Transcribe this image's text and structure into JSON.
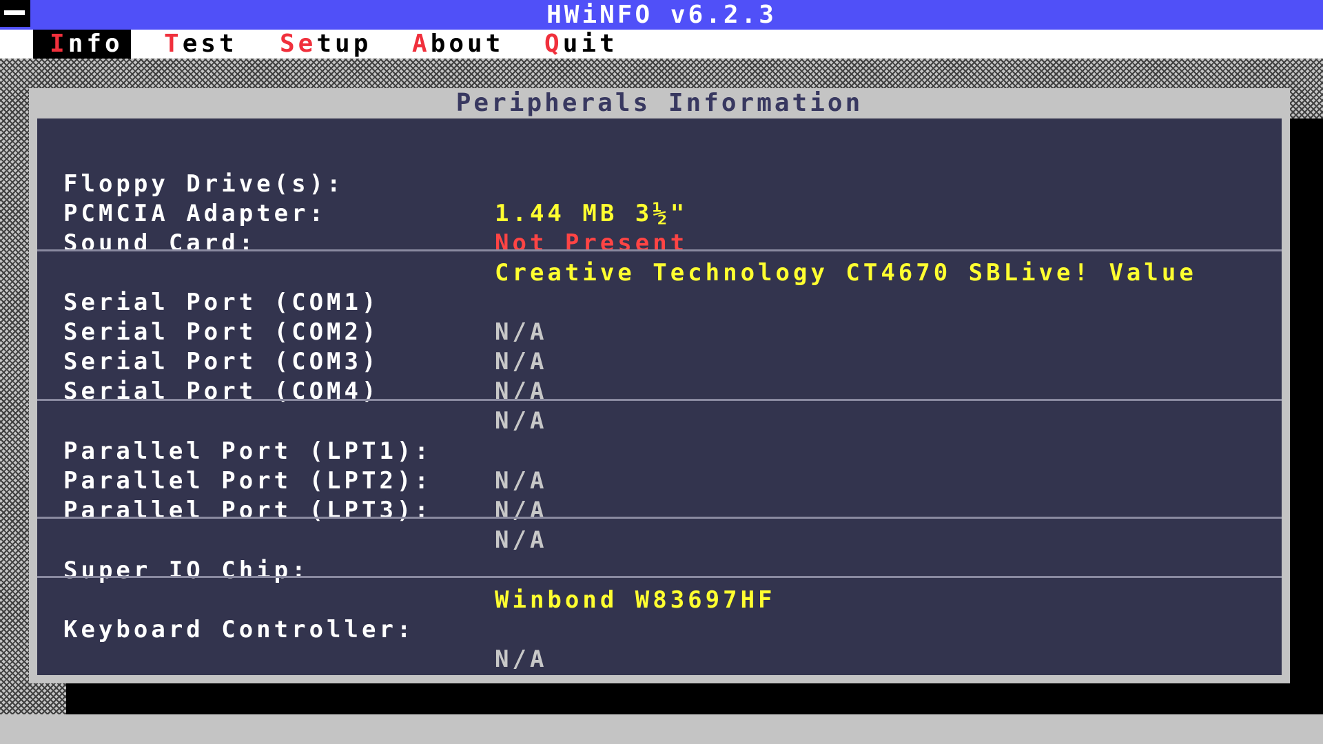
{
  "app": {
    "title": "HWiNFO v6.2.3"
  },
  "menu": [
    {
      "hot": "I",
      "rest": "nfo"
    },
    {
      "hot": "T",
      "rest": "est"
    },
    {
      "hot": "Se",
      "rest": "tup"
    },
    {
      "hot": "A",
      "rest": "bout"
    },
    {
      "hot": "Q",
      "rest": "uit"
    }
  ],
  "window": {
    "title": "Peripherals Information"
  },
  "rows": [
    {
      "label": "Floppy Drive(s):",
      "value": "1.44 MB 3½\""
    },
    {
      "label": "PCMCIA Adapter:",
      "value": "Not Present"
    },
    {
      "label": "Sound Card:",
      "value": "Creative Technology CT4670 SBLive! Value"
    },
    {
      "label": "Serial Port (COM1)",
      "value": "N/A"
    },
    {
      "label": "Serial Port (COM2)",
      "value": "N/A"
    },
    {
      "label": "Serial Port (COM3)",
      "value": "N/A"
    },
    {
      "label": "Serial Port (COM4)",
      "value": "N/A"
    },
    {
      "label": "Parallel Port (LPT1):",
      "value": "N/A"
    },
    {
      "label": "Parallel Port (LPT2):",
      "value": "N/A"
    },
    {
      "label": "Parallel Port (LPT3):",
      "value": "N/A"
    },
    {
      "label": "Super IO Chip:",
      "value": "Winbond W83697HF"
    },
    {
      "label": "Keyboard Controller:",
      "value": "N/A"
    }
  ],
  "colors": {
    "titlebar": "#5050f8",
    "panel": "#33344e",
    "hotkey": "#f0303c",
    "value_present": "#ffff30",
    "value_missing": "#ff4444",
    "value_na": "#c8c8c8"
  }
}
